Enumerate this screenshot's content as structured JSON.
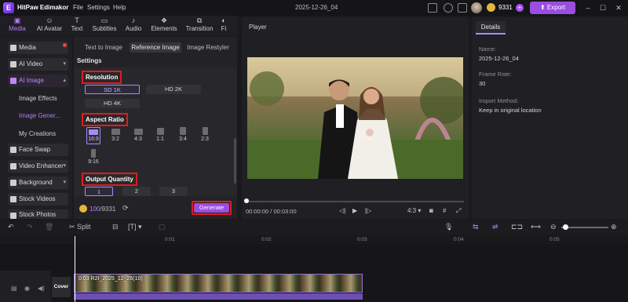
{
  "app": {
    "name": "HitPaw Edimakor",
    "project_title": "2025-12-26_04",
    "menus": [
      "File",
      "Settings",
      "Help"
    ],
    "credits": "9331",
    "export_label": "Export"
  },
  "tabs": [
    {
      "label": "Media",
      "icon": "media-icon",
      "active": true
    },
    {
      "label": "AI Avatar",
      "icon": "ai-avatar-icon"
    },
    {
      "label": "Text",
      "icon": "text-icon"
    },
    {
      "label": "Subtitles",
      "icon": "subtitles-icon"
    },
    {
      "label": "Audio",
      "icon": "audio-icon"
    },
    {
      "label": "Elements",
      "icon": "elements-icon"
    },
    {
      "label": "Transition",
      "icon": "transition-icon"
    },
    {
      "label": "Fi",
      "icon": "filter-icon"
    }
  ],
  "sidebar": {
    "items": [
      {
        "label": "Media"
      },
      {
        "label": "AI Video"
      },
      {
        "label": "AI Image"
      },
      {
        "label": "Face Swap"
      },
      {
        "label": "Video Enhancer"
      },
      {
        "label": "Background"
      },
      {
        "label": "Stock Videos"
      },
      {
        "label": "Stock Photos"
      }
    ],
    "subitems": [
      "Image Effects",
      "Image Gener...",
      "My Creations"
    ]
  },
  "settings": {
    "tabs": [
      "Text to Image",
      "Reference Image",
      "Image Restyler"
    ],
    "title": "Settings",
    "resolution": {
      "heading": "Resolution",
      "options": [
        "SD 1K",
        "HD 2K",
        "HD 4K"
      ]
    },
    "aspect": {
      "heading": "Aspect Ratio",
      "options": [
        "16:9",
        "3:2",
        "4:3",
        "1:1",
        "3:4",
        "2:3",
        "9:16"
      ]
    },
    "output": {
      "heading": "Output Quantity",
      "options": [
        "1",
        "2",
        "3"
      ]
    },
    "credits_used": "100",
    "credits_total": "/9331",
    "generate_label": "Generate"
  },
  "player": {
    "label": "Player",
    "time": "00:00:00 / 00:03:00",
    "ratio": "4:3",
    "progress": 0
  },
  "details": {
    "tab": "Details",
    "name_label": "Name:",
    "name_value": "2025-12-26_04",
    "frame_label": "Frame Rate:",
    "frame_value": "30",
    "import_label": "Import Method:",
    "import_value": "Keep in original location"
  },
  "timeline": {
    "split_label": "Split",
    "ticks": [
      "0:01",
      "0:02",
      "0:03",
      "0:04",
      "0:05"
    ],
    "cover_label": "Cover",
    "clip_label": "0:03 R2I_2025_12_26(10)"
  },
  "colors": {
    "accent": "#9b4de0",
    "highlight": "#e21b1b"
  }
}
